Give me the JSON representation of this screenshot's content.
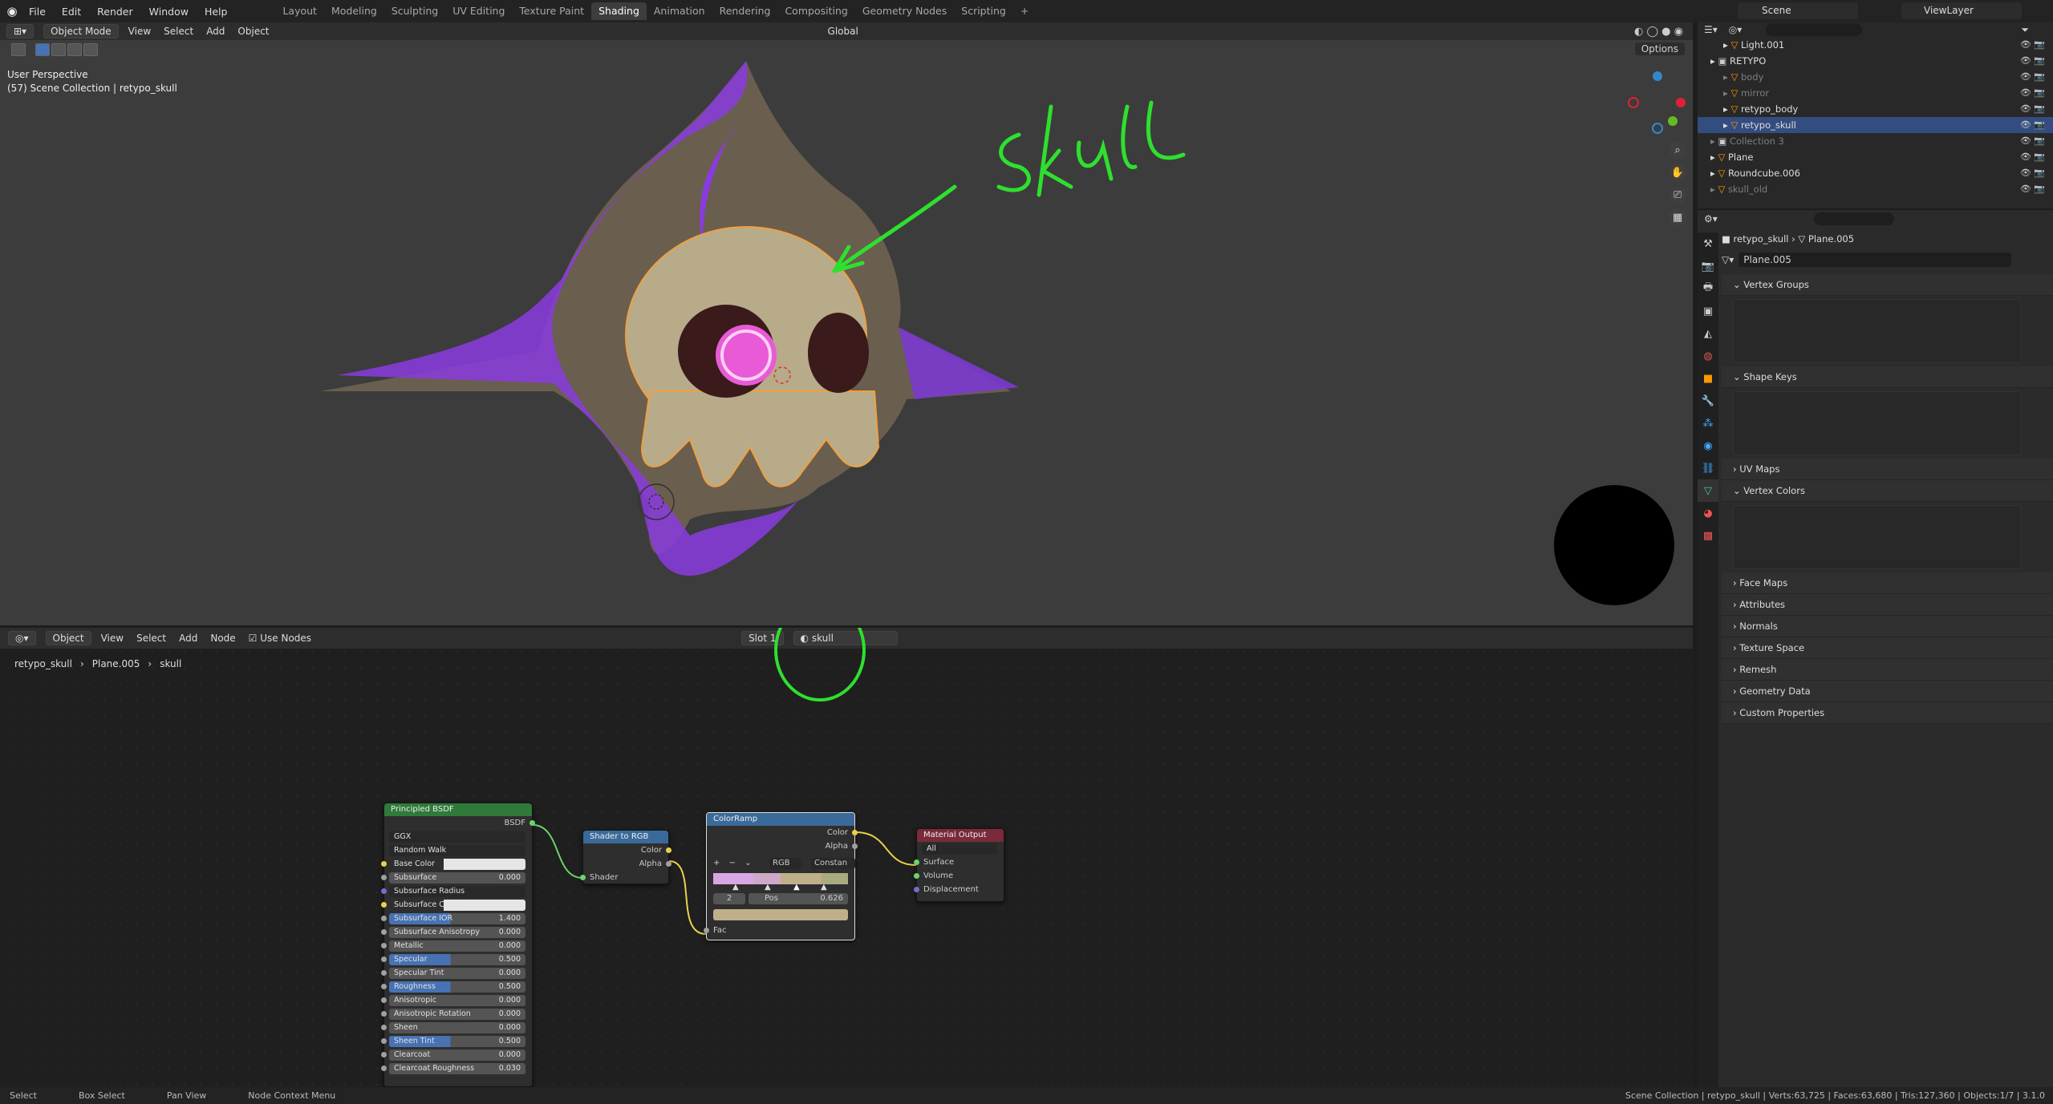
{
  "menu": [
    "File",
    "Edit",
    "Render",
    "Window",
    "Help"
  ],
  "workspaces": [
    "Layout",
    "Modeling",
    "Sculpting",
    "UV Editing",
    "Texture Paint",
    "Shading",
    "Animation",
    "Rendering",
    "Compositing",
    "Geometry Nodes",
    "Scripting"
  ],
  "active_workspace": "Shading",
  "scene": "Scene",
  "view_layer": "ViewLayer",
  "viewport": {
    "mode": "Object Mode",
    "menus": [
      "View",
      "Select",
      "Add",
      "Object"
    ],
    "transform": "Global",
    "options": "Options",
    "info_line1": "User Perspective",
    "info_line2": "(57) Scene Collection | retypo_skull",
    "annotation": "Skull"
  },
  "node_editor": {
    "mode": "Object",
    "menus": [
      "View",
      "Select",
      "Add",
      "Node"
    ],
    "use_nodes": "Use Nodes",
    "slot": "Slot 1",
    "material": "skull",
    "breadcrumbs": [
      "retypo_skull",
      "Plane.005",
      "skull"
    ]
  },
  "nodes": {
    "bsdf": {
      "title": "Principled BSDF",
      "out": "BSDF",
      "dist": "GGX",
      "sss": "Random Walk",
      "fields": [
        {
          "label": "Base Color",
          "value": ""
        },
        {
          "label": "Subsurface",
          "value": "0.000"
        },
        {
          "label": "Subsurface Radius",
          "value": ""
        },
        {
          "label": "Subsurface Col...",
          "value": ""
        },
        {
          "label": "Subsurface IOR",
          "value": "1.400"
        },
        {
          "label": "Subsurface Anisotropy",
          "value": "0.000"
        },
        {
          "label": "Metallic",
          "value": "0.000"
        },
        {
          "label": "Specular",
          "value": "0.500"
        },
        {
          "label": "Specular Tint",
          "value": "0.000"
        },
        {
          "label": "Roughness",
          "value": "0.500"
        },
        {
          "label": "Anisotropic",
          "value": "0.000"
        },
        {
          "label": "Anisotropic Rotation",
          "value": "0.000"
        },
        {
          "label": "Sheen",
          "value": "0.000"
        },
        {
          "label": "Sheen Tint",
          "value": "0.500"
        },
        {
          "label": "Clearcoat",
          "value": "0.000"
        },
        {
          "label": "Clearcoat Roughness",
          "value": "0.030"
        }
      ]
    },
    "s2rgb": {
      "title": "Shader to RGB",
      "color": "Color",
      "alpha": "Alpha",
      "shader": "Shader"
    },
    "ramp": {
      "title": "ColorRamp",
      "color": "Color",
      "alpha": "Alpha",
      "mode": "RGB",
      "interp": "Constan",
      "index": "2",
      "pos_label": "Pos",
      "pos": "0.626",
      "fac": "Fac"
    },
    "output": {
      "title": "Material Output",
      "target": "All",
      "surface": "Surface",
      "volume": "Volume",
      "displacement": "Displacement"
    }
  },
  "outliner": [
    {
      "name": "Light.001",
      "indent": 2,
      "dim": false,
      "sel": false
    },
    {
      "name": "RETYPO",
      "indent": 1,
      "dim": false,
      "sel": false
    },
    {
      "name": "body",
      "indent": 2,
      "dim": true,
      "sel": false
    },
    {
      "name": "mirror",
      "indent": 2,
      "dim": true,
      "sel": false
    },
    {
      "name": "retypo_body",
      "indent": 2,
      "dim": false,
      "sel": false
    },
    {
      "name": "retypo_skull",
      "indent": 2,
      "dim": false,
      "sel": true
    },
    {
      "name": "Collection 3",
      "indent": 1,
      "dim": true,
      "sel": false
    },
    {
      "name": "Plane",
      "indent": 1,
      "dim": false,
      "sel": false
    },
    {
      "name": "Roundcube.006",
      "indent": 1,
      "dim": false,
      "sel": false
    },
    {
      "name": "skull_old",
      "indent": 1,
      "dim": true,
      "sel": false
    }
  ],
  "properties": {
    "object": "retypo_skull",
    "mesh": "Plane.005",
    "data_name": "Plane.005",
    "sections": [
      "Vertex Groups",
      "Shape Keys",
      "UV Maps",
      "Vertex Colors",
      "Face Maps",
      "Attributes",
      "Normals",
      "Texture Space",
      "Remesh",
      "Geometry Data",
      "Custom Properties"
    ]
  },
  "status": {
    "select": "Select",
    "box": "Box Select",
    "pan": "Pan View",
    "ctx": "Node Context Menu",
    "stats": "Scene Collection | retypo_skull | Verts:63,725 | Faces:63,680 | Tris:127,360 | Objects:1/7 | 3.1.0"
  },
  "colors": {
    "accent": "#4772b3",
    "annotation": "#2ee02e",
    "purple": "#8a3be0",
    "skull": "#b7ab8a",
    "pink": "#e85ad6"
  }
}
